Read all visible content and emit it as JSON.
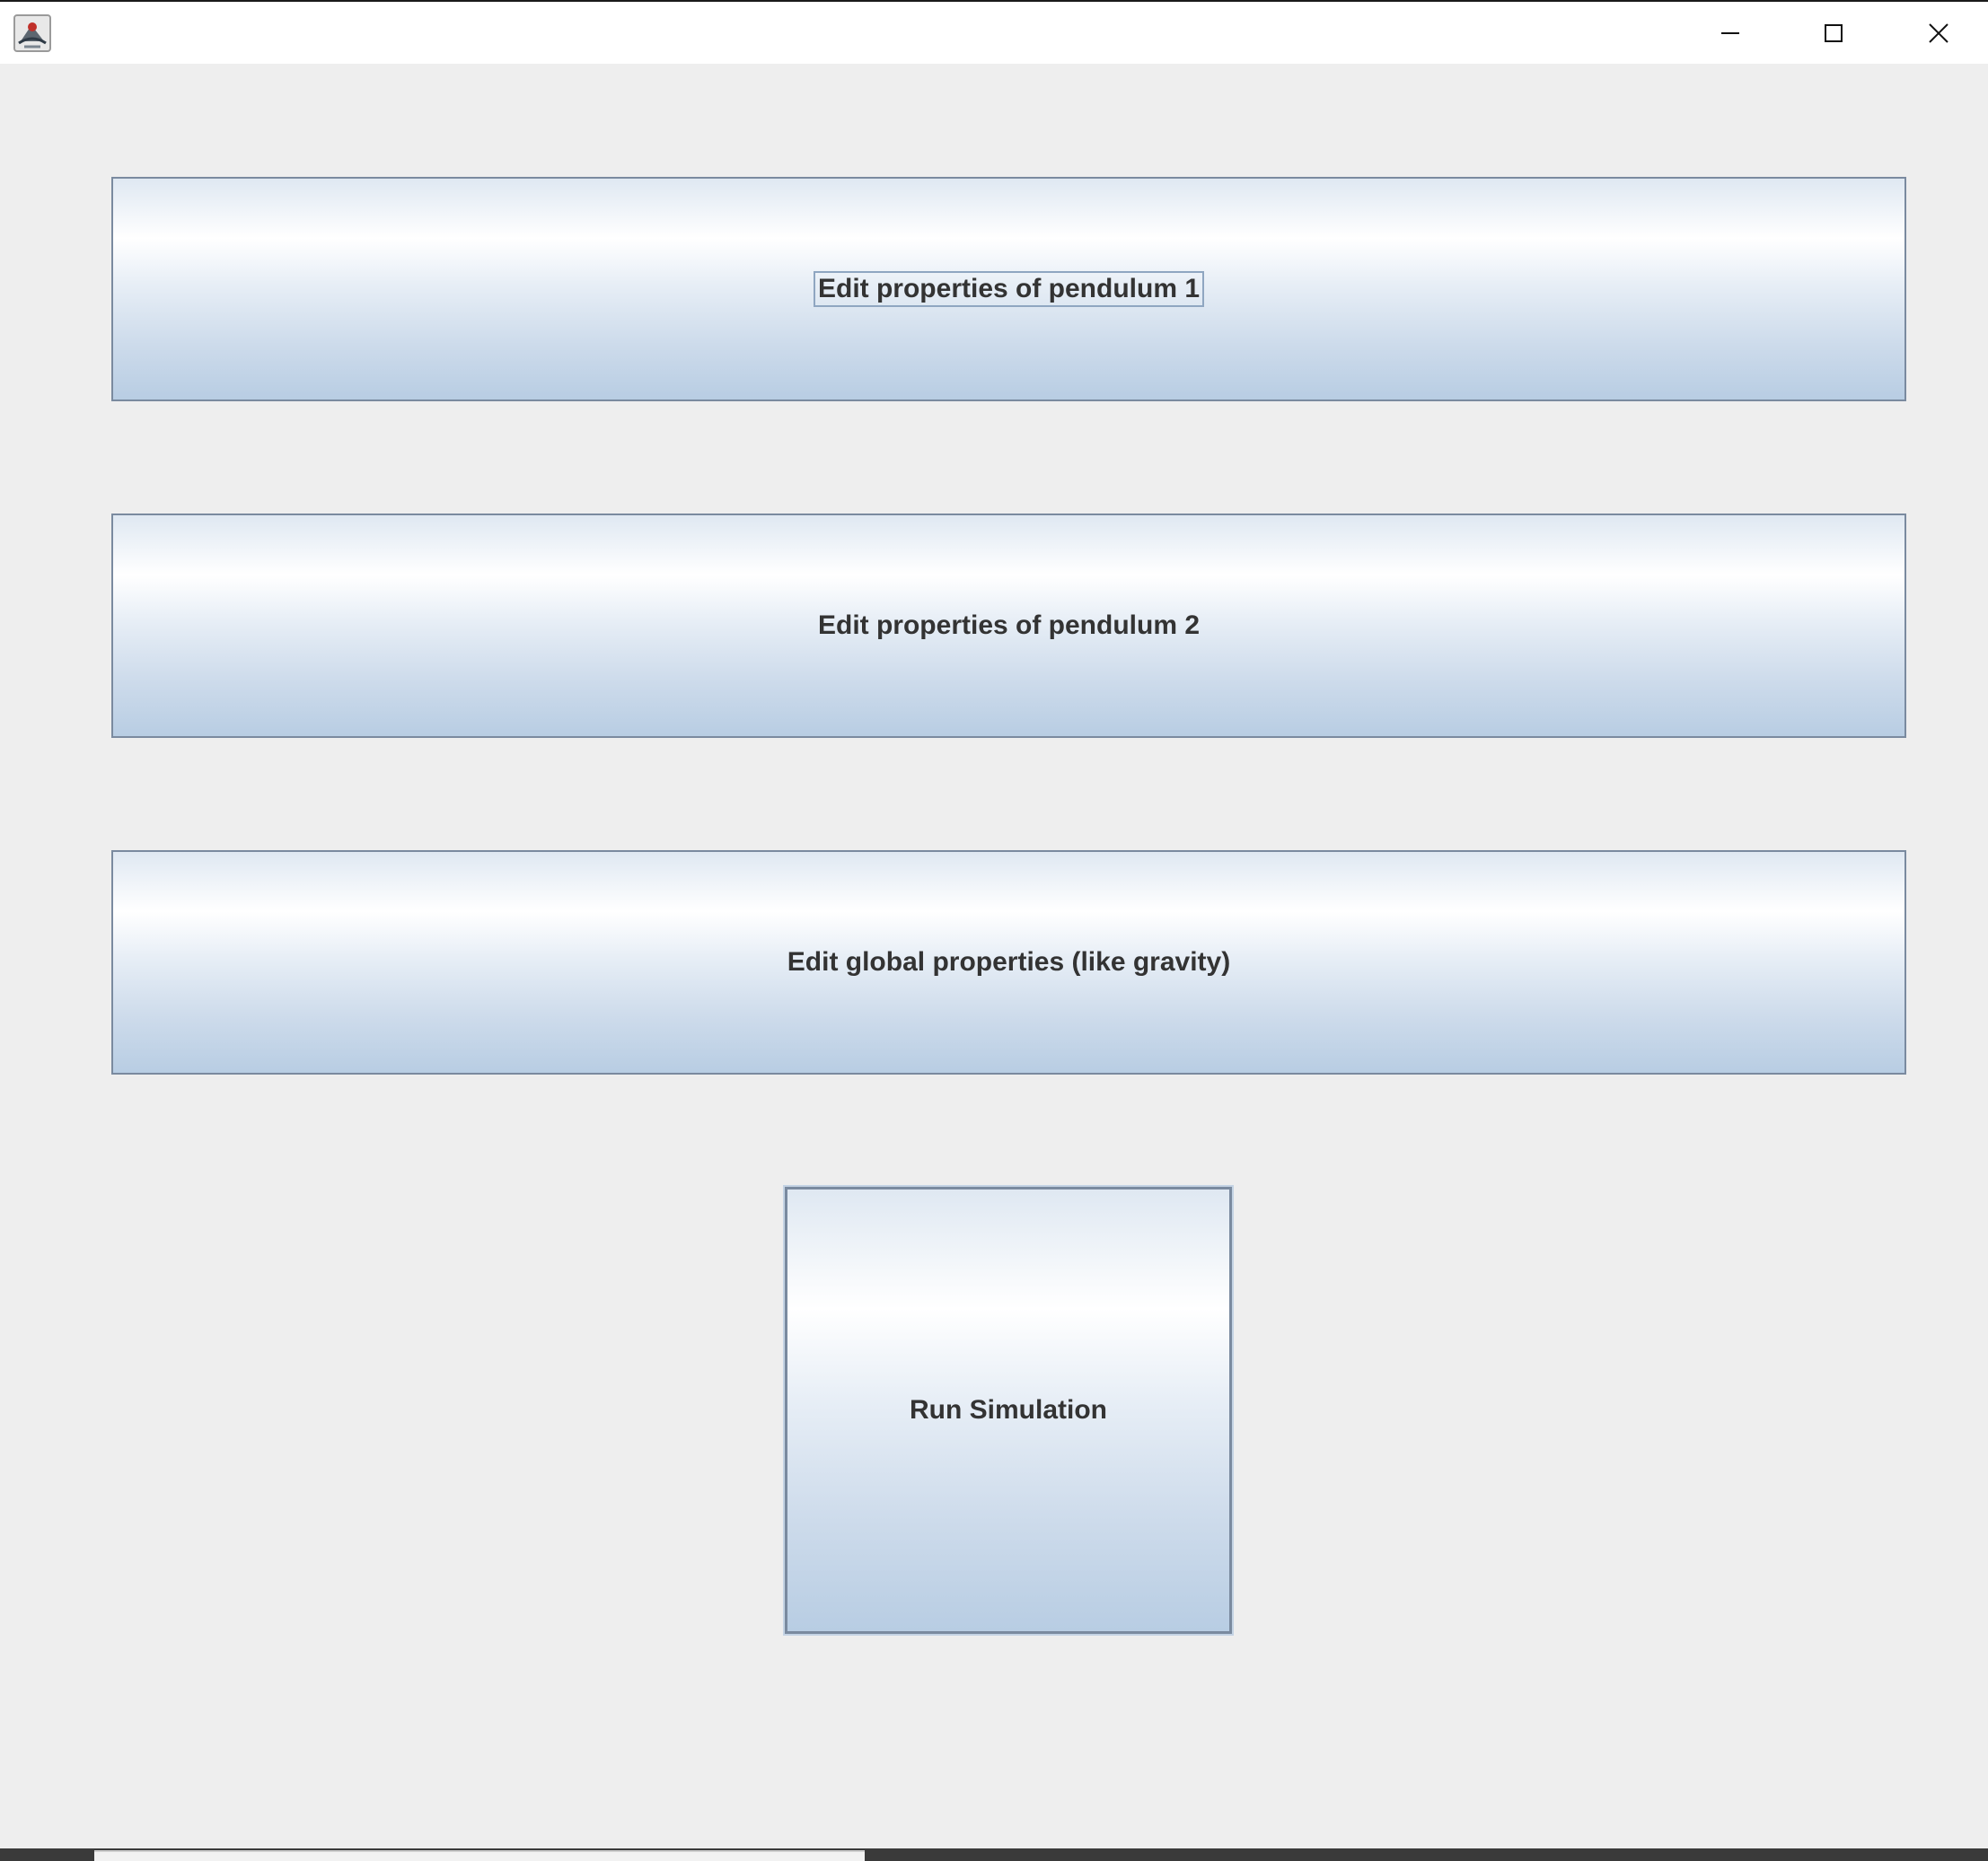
{
  "window": {
    "icon": "java-app-icon",
    "controls": {
      "minimize": "minimize-icon",
      "maximize": "maximize-icon",
      "close": "close-icon"
    }
  },
  "buttons": {
    "pendulum1": "Edit properties of pendulum 1",
    "pendulum2": "Edit properties of pendulum 2",
    "global": "Edit global properties (like gravity)",
    "run": "Run Simulation"
  },
  "colors": {
    "background": "#eeeeee",
    "button_border": "#7a8a9f",
    "button_gradient_top": "#ffffff",
    "button_gradient_bottom": "#b8cde3",
    "text": "#333333"
  }
}
